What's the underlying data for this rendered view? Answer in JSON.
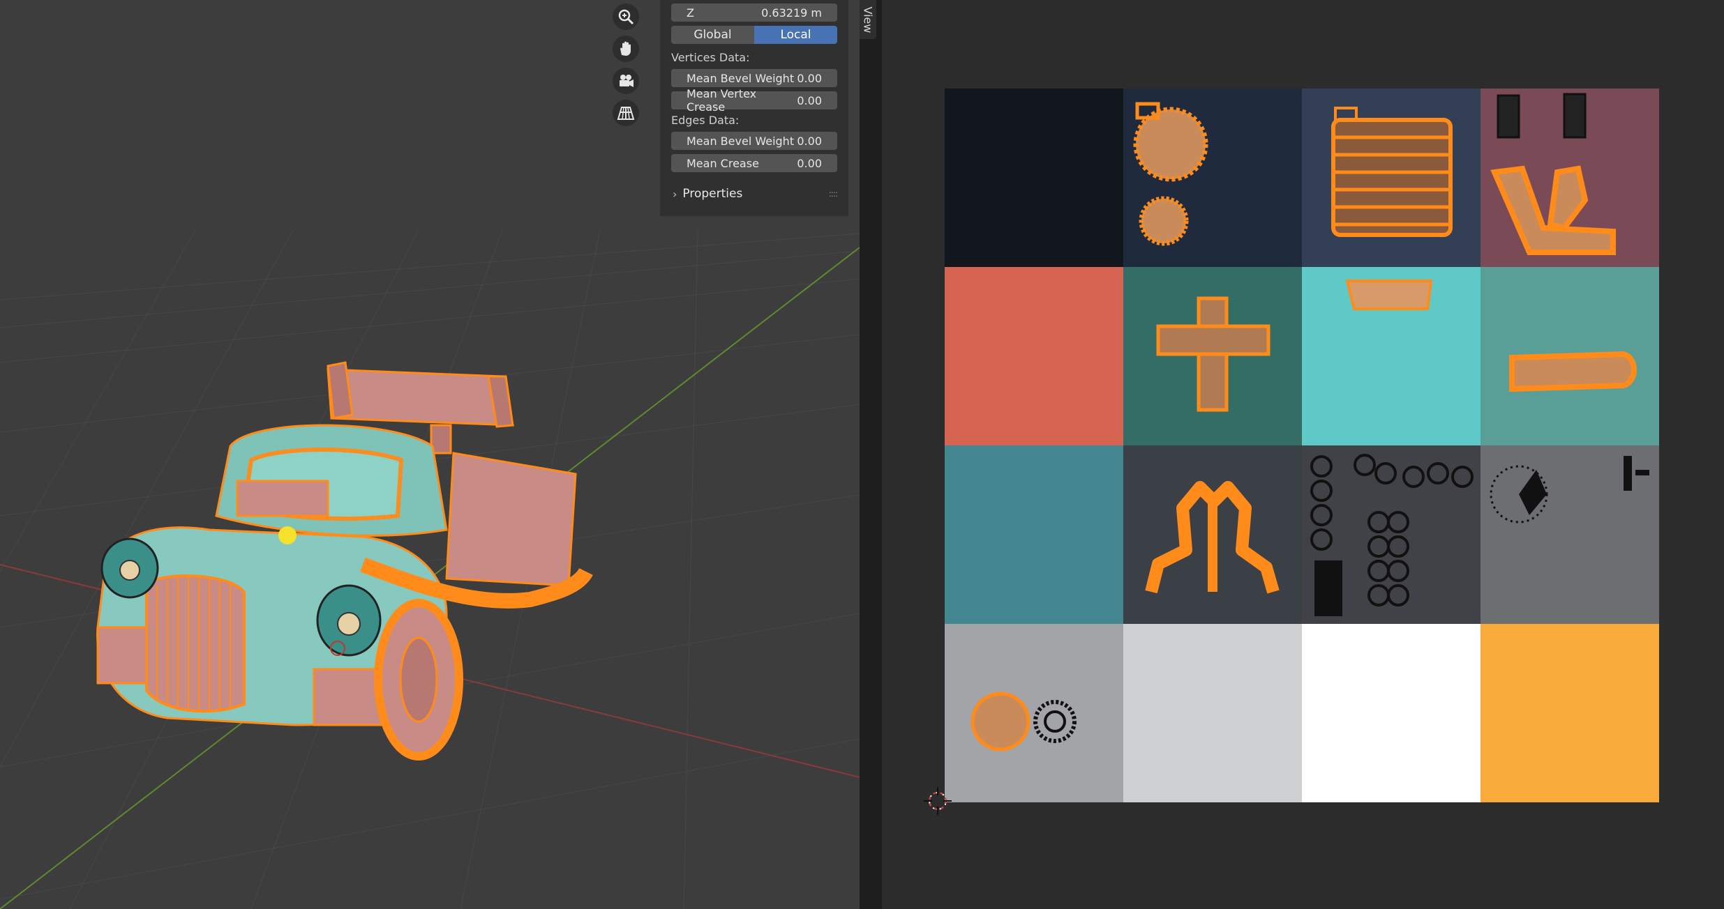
{
  "npanel": {
    "z_label": "Z",
    "z_value": "0.63219 m",
    "global_label": "Global",
    "local_label": "Local",
    "vertices_heading": "Vertices Data:",
    "mean_bevel_weight_label": "Mean Bevel Weight",
    "mean_bevel_weight_value": "0.00",
    "mean_vertex_crease_label": "Mean Vertex Crease",
    "mean_vertex_crease_value": "0.00",
    "edges_heading": "Edges Data:",
    "edge_bevel_weight_label": "Mean Bevel Weight",
    "edge_bevel_weight_value": "0.00",
    "mean_crease_label": "Mean Crease",
    "mean_crease_value": "0.00",
    "properties_label": "Properties"
  },
  "sidebar_tab": {
    "view_label": "View"
  },
  "icons": [
    "zoom-icon",
    "hand-pan-icon",
    "camera-icon",
    "perspective-grid-icon",
    "chevron-right-icon",
    "cursor-2d-icon"
  ],
  "colors": {
    "accent_blue": "#4772b3",
    "wire_orange": "#ff8c1a",
    "palette": [
      "#12161d",
      "#1f2b3d",
      "#323f55",
      "#7a4a56",
      "#d66452",
      "#346d65",
      "#5ec9c6",
      "#5a9f97",
      "#42868f",
      "#3b3f46",
      "#404248",
      "#6c6e72",
      "#a3a4a8",
      "#cfd0d2",
      "#ffffff",
      "#f8aa3a"
    ]
  }
}
